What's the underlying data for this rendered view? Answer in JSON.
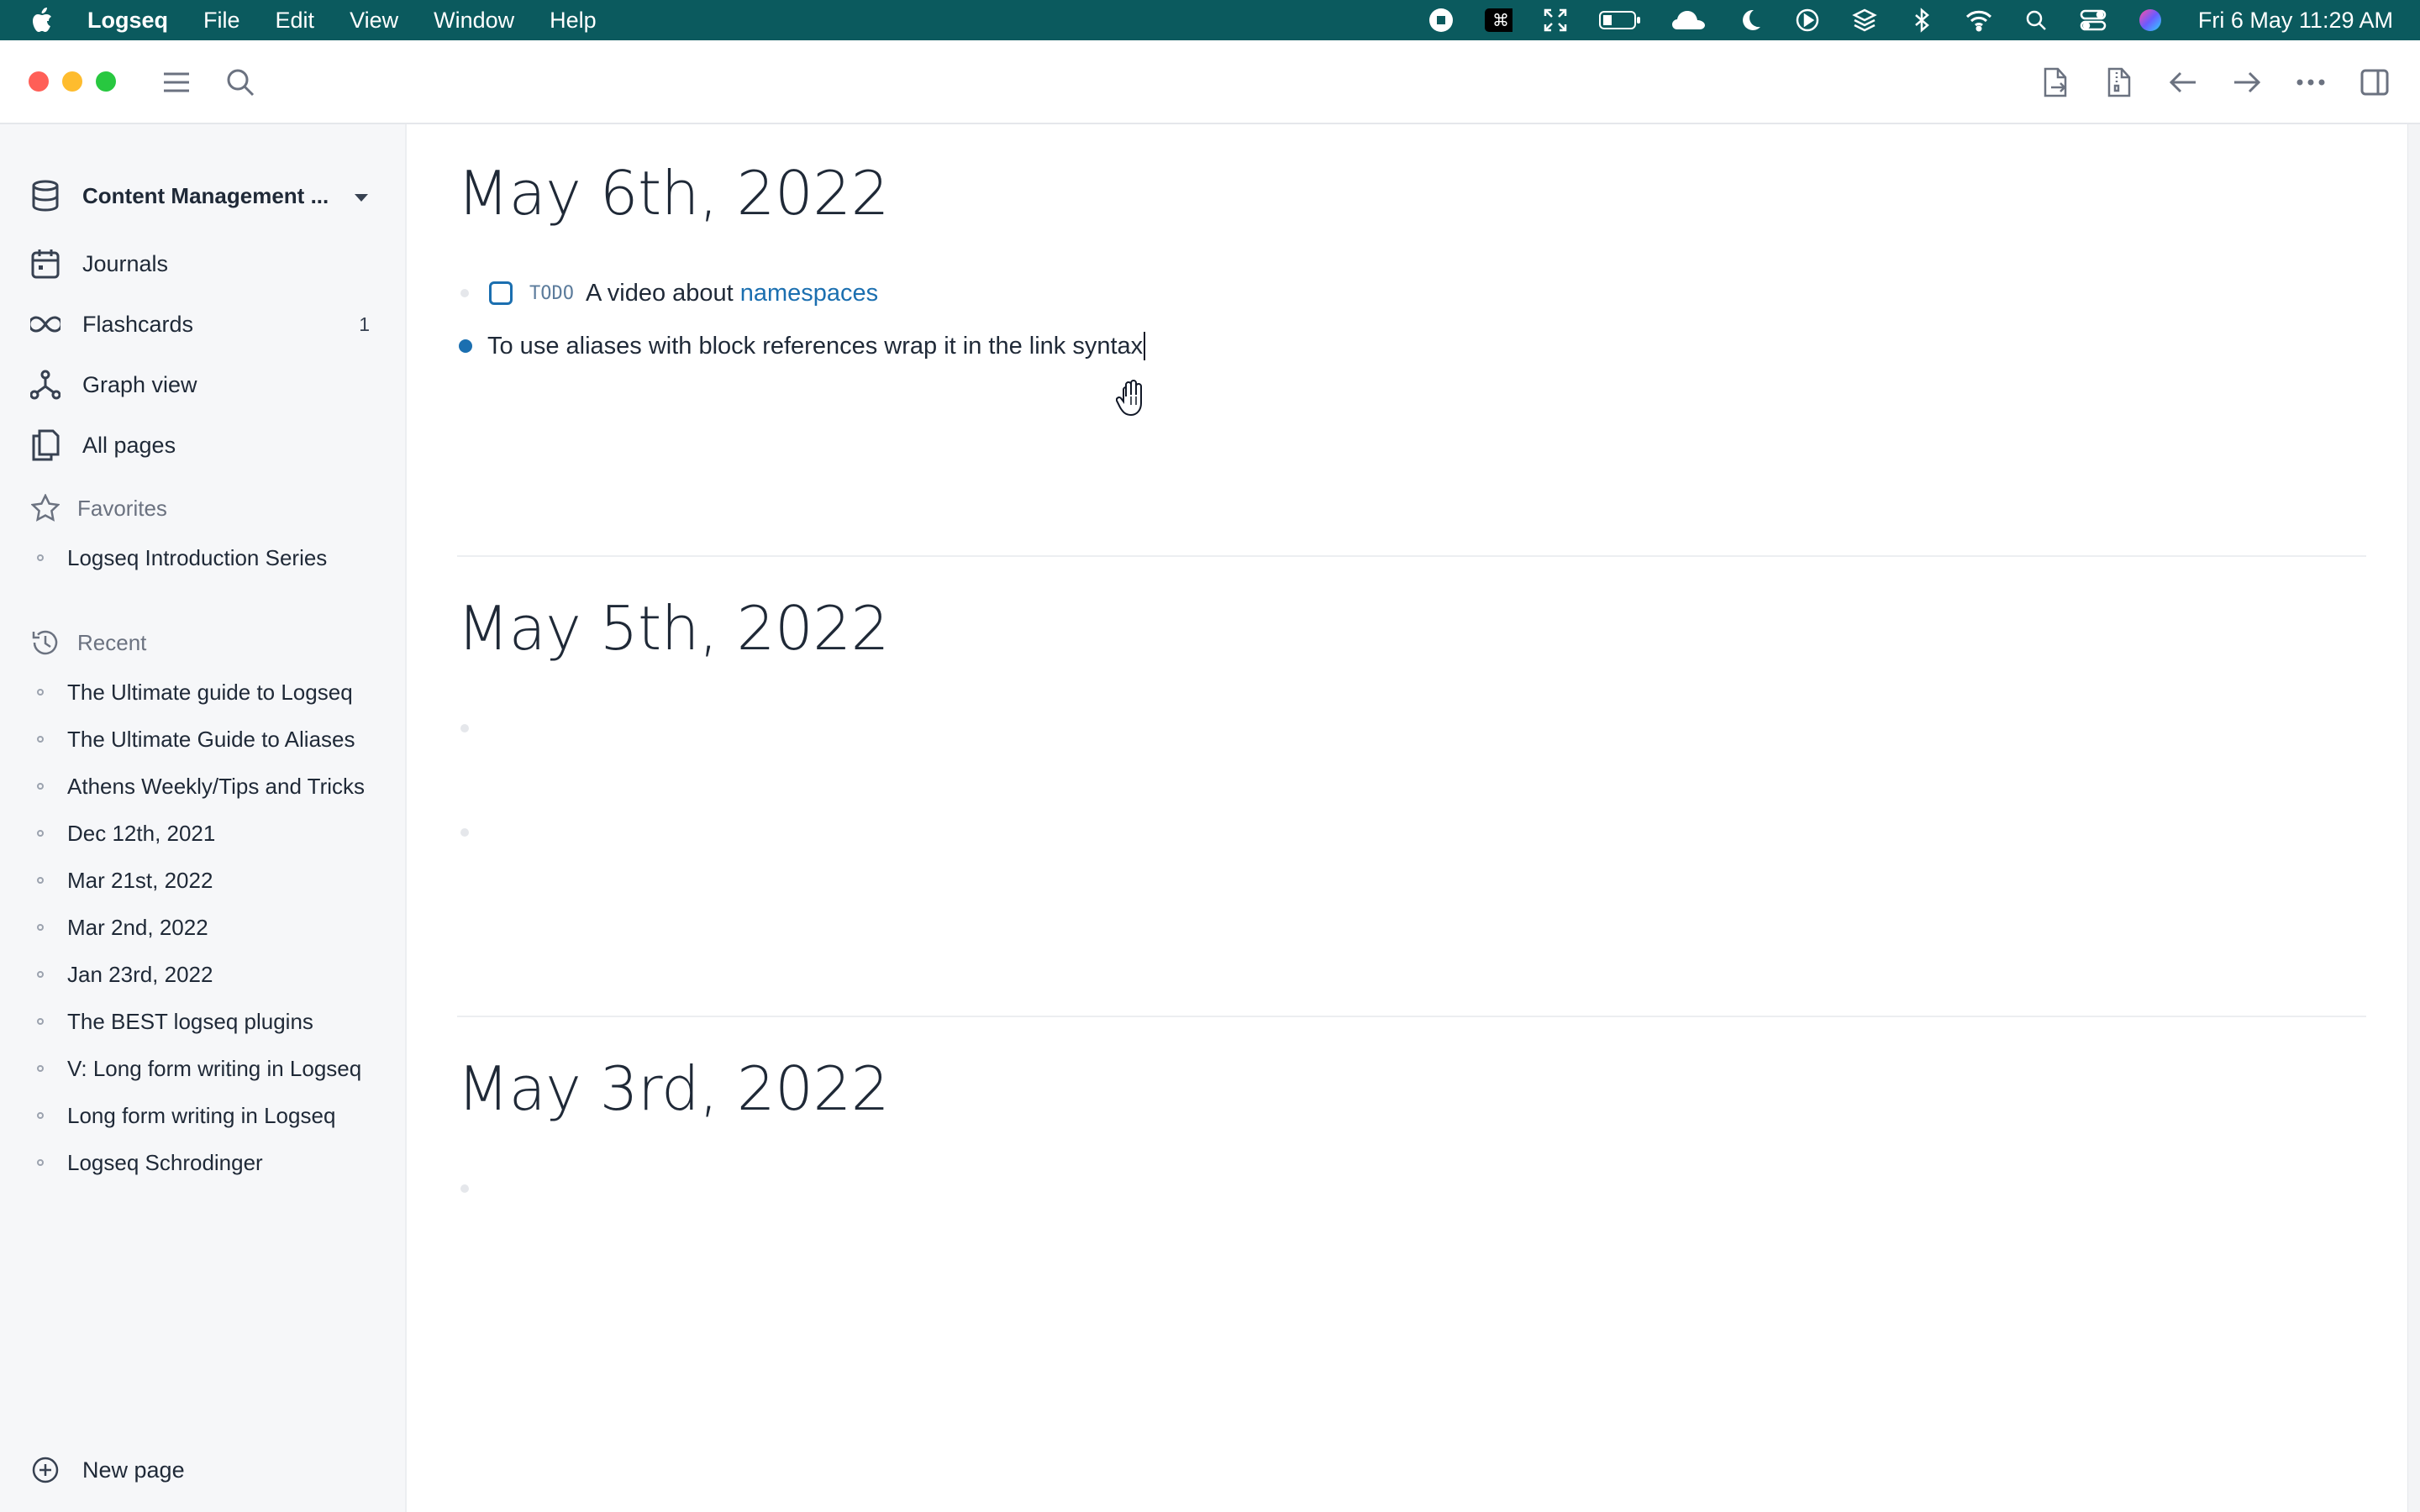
{
  "menubar": {
    "app_name": "Logseq",
    "items": [
      "File",
      "Edit",
      "View",
      "Window",
      "Help"
    ],
    "clock": "Fri 6 May  11:29 AM",
    "status_icons": [
      "record-icon",
      "command-icon",
      "fullscreen-icon",
      "battery-icon",
      "cloud-icon",
      "moon-icon",
      "play-icon",
      "layers-icon",
      "bluetooth-icon",
      "wifi-icon",
      "search-icon",
      "control-center-icon",
      "siri-icon"
    ]
  },
  "colors": {
    "menubar_bg": "#0b5a5e",
    "accent": "#1b6fb0",
    "sidebar_bg": "#f6f7f9",
    "traffic_red": "#ff5f57",
    "traffic_yellow": "#febc2e",
    "traffic_green": "#28c840"
  },
  "sidebar": {
    "graph_name": "Content Management ...",
    "nav": [
      {
        "label": "Journals",
        "icon": "calendar-icon"
      },
      {
        "label": "Flashcards",
        "icon": "infinity-icon",
        "badge": "1"
      },
      {
        "label": "Graph view",
        "icon": "graph-icon"
      },
      {
        "label": "All pages",
        "icon": "pages-icon"
      }
    ],
    "favorites_label": "Favorites",
    "favorites": [
      "Logseq Introduction Series"
    ],
    "recent_label": "Recent",
    "recent": [
      "The Ultimate guide to Logseq",
      "The Ultimate Guide to Aliases",
      "Athens Weekly/Tips and Tricks",
      "Dec 12th, 2021",
      "Mar 21st, 2022",
      "Mar 2nd, 2022",
      "Jan 23rd, 2022",
      "The BEST logseq plugins",
      "V: Long form writing in Logseq",
      "Long form writing in Logseq",
      "Logseq Schrodinger"
    ],
    "new_page_label": "New page"
  },
  "journals": [
    {
      "title": "May 6th, 2022",
      "todo_marker": "TODO",
      "todo_text": "A video about",
      "todo_link": "namespaces",
      "editing_text": "To use aliases with block references wrap it in the link syntax"
    },
    {
      "title": "May 5th, 2022"
    },
    {
      "title": "May 3rd, 2022"
    }
  ]
}
